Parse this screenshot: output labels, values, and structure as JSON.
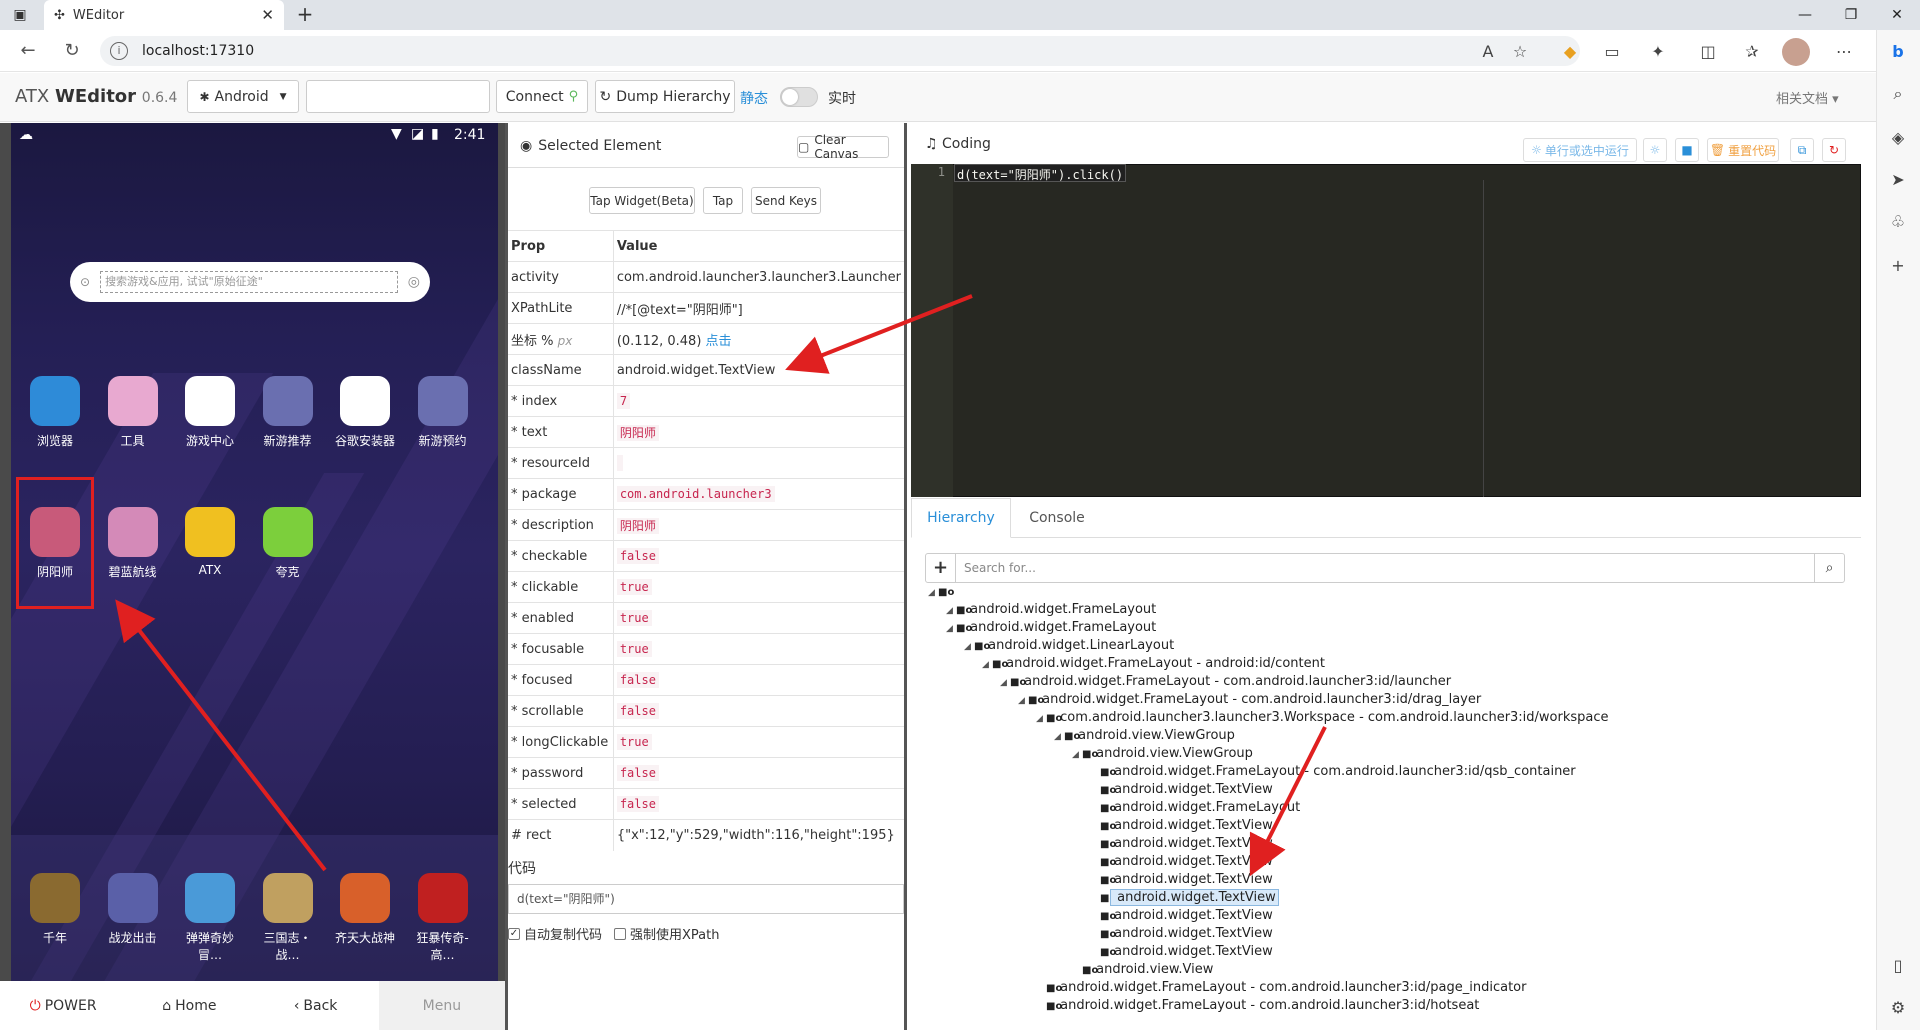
{
  "browser": {
    "tab_title": "WEditor",
    "url": "localhost:17310"
  },
  "app": {
    "brand": "ATX",
    "brand_bold": "WEditor",
    "version": "0.6.4",
    "platform": "Android",
    "serial_value": "",
    "connect_label": "Connect",
    "dump_label": "Dump Hierarchy",
    "static_label": "静态",
    "realtime_label": "实时",
    "docs_label": "相关文档"
  },
  "phone": {
    "time": "2:41",
    "search_placeholder": "搜索游戏&应用, 试试\"原始征途\"",
    "apps_row1": [
      {
        "label": "浏览器",
        "icon": "browser-icon",
        "color": "#2e8bd8"
      },
      {
        "label": "工具",
        "icon": "tools-icon",
        "color": "#e8a9d0"
      },
      {
        "label": "游戏中心",
        "icon": "gamepad-icon",
        "color": "#ffffff"
      },
      {
        "label": "新游推荐",
        "icon": "game-art-icon",
        "color": "#6a6fb0"
      },
      {
        "label": "谷歌安装器",
        "icon": "google-icon",
        "color": "#ffffff"
      },
      {
        "label": "新游预约",
        "icon": "game-art-icon",
        "color": "#6a6fb0"
      }
    ],
    "apps_row2": [
      {
        "label": "阴阳师",
        "icon": "onmyoji-icon",
        "color": "#c85a7a"
      },
      {
        "label": "碧蓝航线",
        "icon": "azurlane-icon",
        "color": "#d48ab8"
      },
      {
        "label": "ATX",
        "icon": "taxi-icon",
        "color": "#f0c020"
      },
      {
        "label": "夸克",
        "icon": "android-icon",
        "color": "#7ccf3c"
      }
    ],
    "dock": [
      {
        "label": "千年",
        "color": "#8a6a30"
      },
      {
        "label": "战龙出击",
        "color": "#5a60a8"
      },
      {
        "label": "弹弹奇妙冒…",
        "color": "#4a9ad8"
      },
      {
        "label": "三国志・战…",
        "color": "#c0a060"
      },
      {
        "label": "齐天大战神",
        "color": "#d8602a"
      },
      {
        "label": "狂暴传奇-高…",
        "color": "#c02020"
      }
    ],
    "buttons": {
      "power": "POWER",
      "home": "Home",
      "back": "Back",
      "menu": "Menu"
    }
  },
  "selected": {
    "title": "Selected Element",
    "clear_canvas": "Clear Canvas",
    "tap_widget": "Tap Widget(Beta)",
    "tap": "Tap",
    "send_keys": "Send Keys",
    "col_prop": "Prop",
    "col_value": "Value",
    "props": {
      "activity_k": "activity",
      "activity_v": "com.android.launcher3.launcher3.Launcher",
      "xpath_k": "XPathLite",
      "xpath_v": "//*[@text=\"阴阳师\"]",
      "coord_k": "坐标 %",
      "coord_unit": "px",
      "coord_v": "(0.112, 0.48)",
      "coord_link": "点击",
      "class_k": "className",
      "class_v": "android.widget.TextView",
      "index_k": "* index",
      "index_v": "7",
      "text_k": "* text",
      "text_v": "阴阳师",
      "rid_k": "* resourceId",
      "rid_v": "",
      "pkg_k": "* package",
      "pkg_v": "com.android.launcher3",
      "desc_k": "* description",
      "desc_v": "阴阳师",
      "checkable_k": "* checkable",
      "checkable_v": "false",
      "clickable_k": "* clickable",
      "clickable_v": "true",
      "enabled_k": "* enabled",
      "enabled_v": "true",
      "focusable_k": "* focusable",
      "focusable_v": "true",
      "focused_k": "* focused",
      "focused_v": "false",
      "scrollable_k": "* scrollable",
      "scrollable_v": "false",
      "long_k": "* longClickable",
      "long_v": "true",
      "password_k": "* password",
      "password_v": "false",
      "selected_k": "* selected",
      "selected_v": "false",
      "rect_k": "# rect",
      "rect_v": "{\"x\":12,\"y\":529,\"width\":116,\"height\":195}"
    },
    "code_label": "代码",
    "code_value": "d(text=\"阴阳师\")",
    "auto_copy": "自动复制代码",
    "force_xpath": "强制使用XPath"
  },
  "coding": {
    "title": "Coding",
    "run_line": "单行或选中运行",
    "reset_code": "重置代码",
    "line_no": "1",
    "code": "d(text=\"阴阳师\").click()"
  },
  "hierarchy": {
    "tab_hierarchy": "Hierarchy",
    "tab_console": "Console",
    "search_placeholder": "Search for...",
    "nodes": [
      "",
      "android.widget.FrameLayout",
      "android.widget.FrameLayout",
      "android.widget.LinearLayout",
      "android.widget.FrameLayout - android:id/content",
      "android.widget.FrameLayout - com.android.launcher3:id/launcher",
      "android.widget.FrameLayout - com.android.launcher3:id/drag_layer",
      "com.android.launcher3.launcher3.Workspace - com.android.launcher3:id/workspace",
      "android.view.ViewGroup",
      "android.view.ViewGroup",
      "android.widget.FrameLayout - com.android.launcher3:id/qsb_container",
      "android.widget.TextView",
      "android.widget.FrameLayout",
      "android.widget.TextView",
      "android.widget.TextView",
      "android.widget.TextView",
      "android.widget.TextView",
      "android.widget.TextView",
      "android.widget.TextView",
      "android.widget.TextView",
      "android.widget.TextView",
      "android.view.View",
      "android.widget.FrameLayout - com.android.launcher3:id/page_indicator",
      "android.widget.FrameLayout - com.android.launcher3:id/hotseat"
    ]
  },
  "colors": {
    "accent": "#2a8fd8",
    "arrow": "#e02020",
    "editor_bg": "#272822"
  }
}
